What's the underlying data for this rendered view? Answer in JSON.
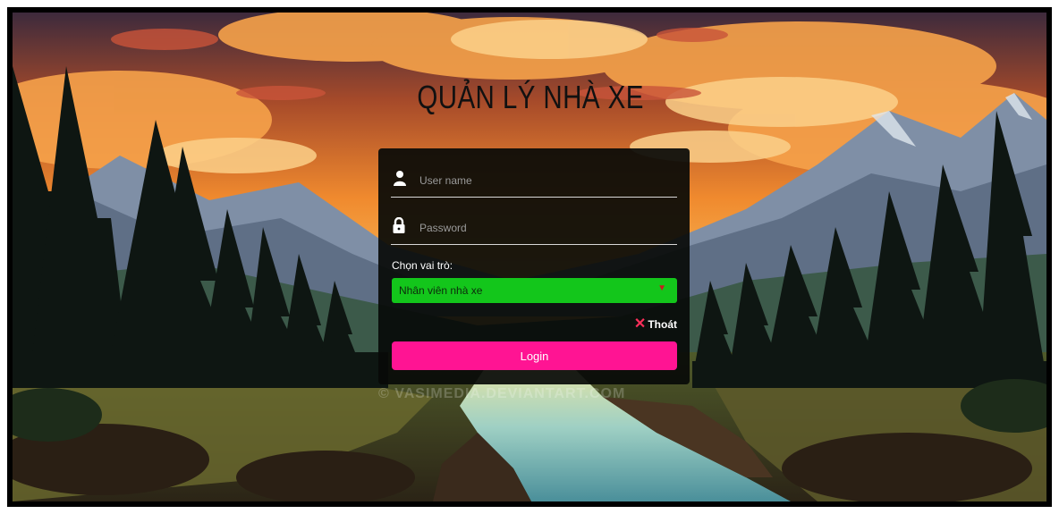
{
  "app": {
    "title": "QUẢN LÝ NHÀ XE"
  },
  "login_form": {
    "username_placeholder": "User name",
    "password_placeholder": "Password",
    "role_label": "Chọn vai trò:",
    "role_selected": "Nhân viên nhà xe",
    "exit_label": "Thoát",
    "login_label": "Login",
    "username_icon": "user-icon",
    "password_icon": "lock-icon"
  },
  "background": {
    "watermark_text": "© VASIMEDIA.DEVIANTART.COM"
  },
  "colors": {
    "role_select_bg": "#13c61b",
    "login_button_bg": "#ff1493",
    "exit_icon": "#ff2f5a",
    "card_bg": "#080a08"
  }
}
